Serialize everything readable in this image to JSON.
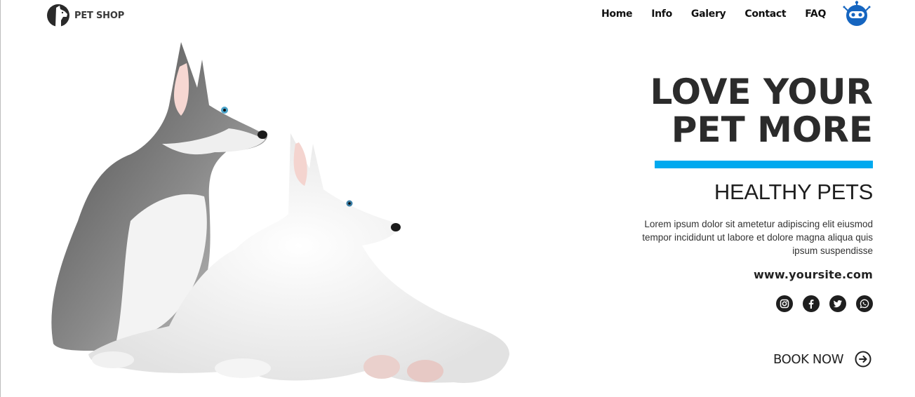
{
  "brand": {
    "logo_text": "PET SHOP",
    "logo_icon": "dog-silhouette-icon"
  },
  "nav": {
    "items": [
      "Home",
      "Info",
      "Galery",
      "Contact",
      "FAQ"
    ]
  },
  "assistant": {
    "icon": "robot-icon",
    "color": "#1565c0"
  },
  "hero": {
    "headline_line1": "LOVE YOUR",
    "headline_line2": "PET MORE",
    "accent_color": "#00a9ef",
    "subheadline": "HEALTHY PETS",
    "body_line1": "Lorem ipsum dolor sit ametetur adipiscing elit eiusmod",
    "body_line2": "tempor incididunt ut labore et dolore magna aliqua quis",
    "body_line3": "ipsum suspendisse",
    "website": "www.yoursite.com",
    "image": "two-husky-puppies-photo"
  },
  "social": [
    "instagram-icon",
    "facebook-icon",
    "twitter-icon",
    "whatsapp-icon"
  ],
  "cta": {
    "label": "BOOK NOW",
    "icon": "arrow-circle-right-icon"
  }
}
